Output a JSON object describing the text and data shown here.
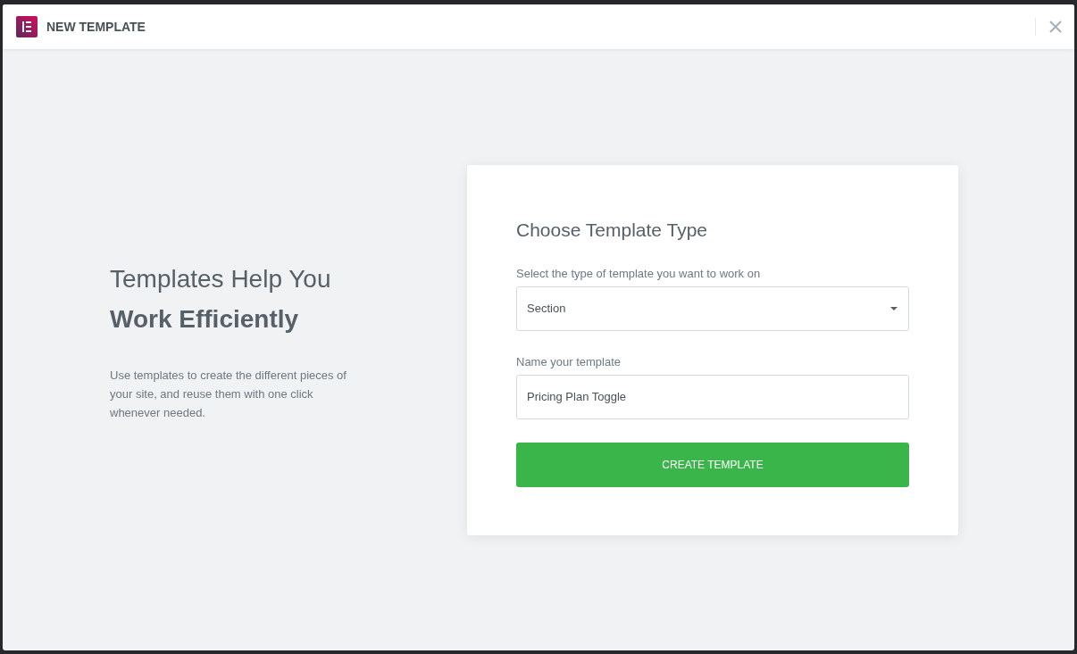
{
  "header": {
    "title": "NEW TEMPLATE"
  },
  "intro": {
    "heading": "Templates Help You",
    "heading_bold": "Work Efficiently",
    "description": "Use templates to create the different pieces of your site, and reuse them with one click whenever needed."
  },
  "form": {
    "title": "Choose Template Type",
    "type_field": {
      "label": "Select the type of template you want to work on",
      "value": "Section"
    },
    "name_field": {
      "label": "Name your template",
      "value": "Pricing Plan Toggle"
    },
    "submit": "CREATE TEMPLATE"
  }
}
